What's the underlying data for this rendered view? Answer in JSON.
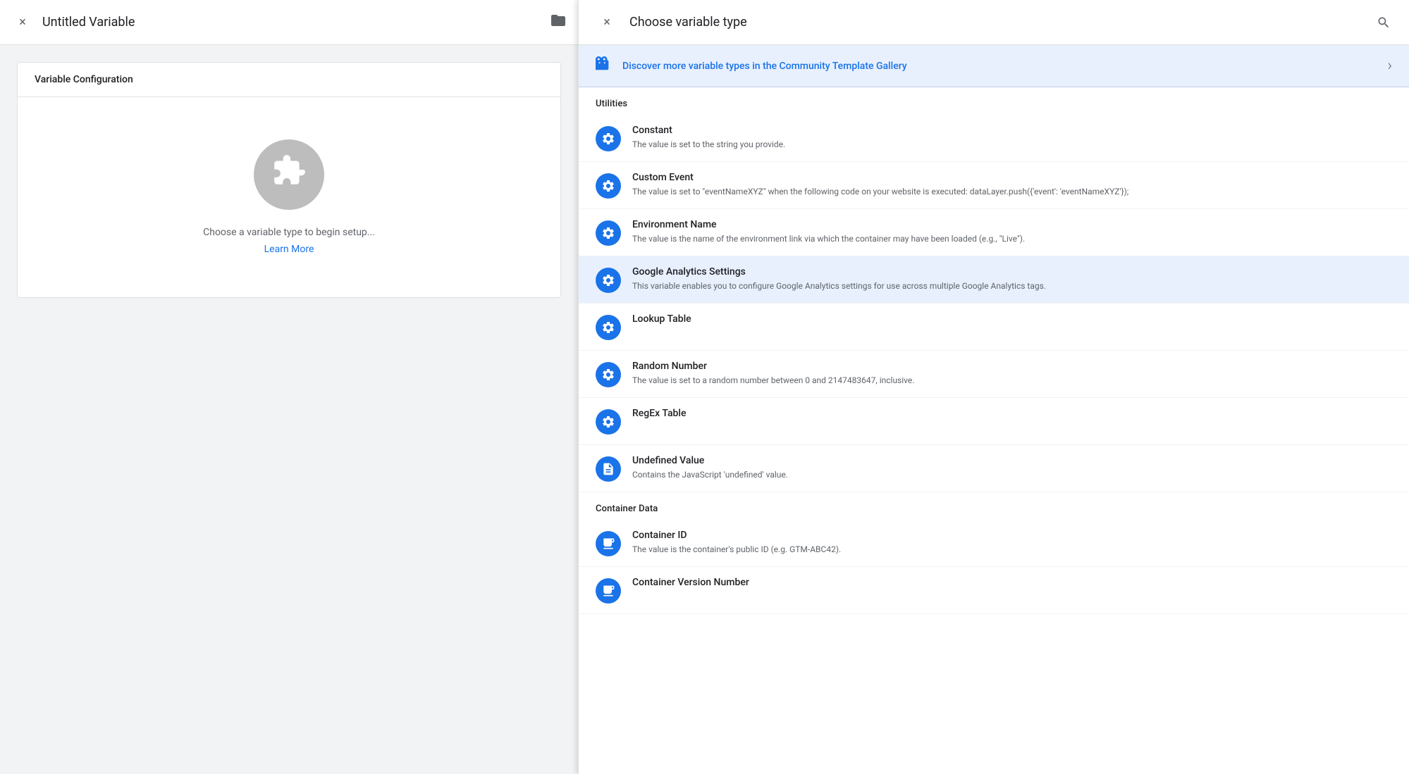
{
  "main": {
    "close_label": "×",
    "title": "Untitled Variable",
    "folder_icon": "🗂",
    "config_section": {
      "header": "Variable Configuration",
      "placeholder_text": "Choose a variable type to begin setup...",
      "learn_more": "Learn More"
    }
  },
  "right_panel": {
    "close_label": "×",
    "title": "Choose variable type",
    "search_icon": "🔍",
    "community_banner": {
      "text": "Discover more variable types in the Community Template Gallery",
      "chevron": "›"
    },
    "sections": [
      {
        "id": "utilities",
        "label": "Utilities",
        "items": [
          {
            "id": "constant",
            "name": "Constant",
            "desc": "The value is set to the string you provide.",
            "icon_type": "gear"
          },
          {
            "id": "custom-event",
            "name": "Custom Event",
            "desc": "The value is set to \"eventNameXYZ\" when the following code on your website is executed: dataLayer.push({'event': 'eventNameXYZ'});",
            "icon_type": "gear"
          },
          {
            "id": "environment-name",
            "name": "Environment Name",
            "desc": "The value is the name of the environment link via which the container may have been loaded (e.g., \"Live\").",
            "icon_type": "gear"
          },
          {
            "id": "google-analytics-settings",
            "name": "Google Analytics Settings",
            "desc": "This variable enables you to configure Google Analytics settings for use across multiple Google Analytics tags.",
            "icon_type": "gear",
            "highlighted": true
          },
          {
            "id": "lookup-table",
            "name": "Lookup Table",
            "desc": "",
            "icon_type": "gear"
          },
          {
            "id": "random-number",
            "name": "Random Number",
            "desc": "The value is set to a random number between 0 and 2147483647, inclusive.",
            "icon_type": "gear"
          },
          {
            "id": "regex-table",
            "name": "RegEx Table",
            "desc": "",
            "icon_type": "gear"
          },
          {
            "id": "undefined-value",
            "name": "Undefined Value",
            "desc": "Contains the JavaScript 'undefined' value.",
            "icon_type": "doc"
          }
        ]
      },
      {
        "id": "container-data",
        "label": "Container Data",
        "items": [
          {
            "id": "container-id",
            "name": "Container ID",
            "desc": "The value is the container's public ID (e.g. GTM-ABC42).",
            "icon_type": "box"
          },
          {
            "id": "container-version-number",
            "name": "Container Version Number",
            "desc": "",
            "icon_type": "box"
          }
        ]
      }
    ]
  }
}
